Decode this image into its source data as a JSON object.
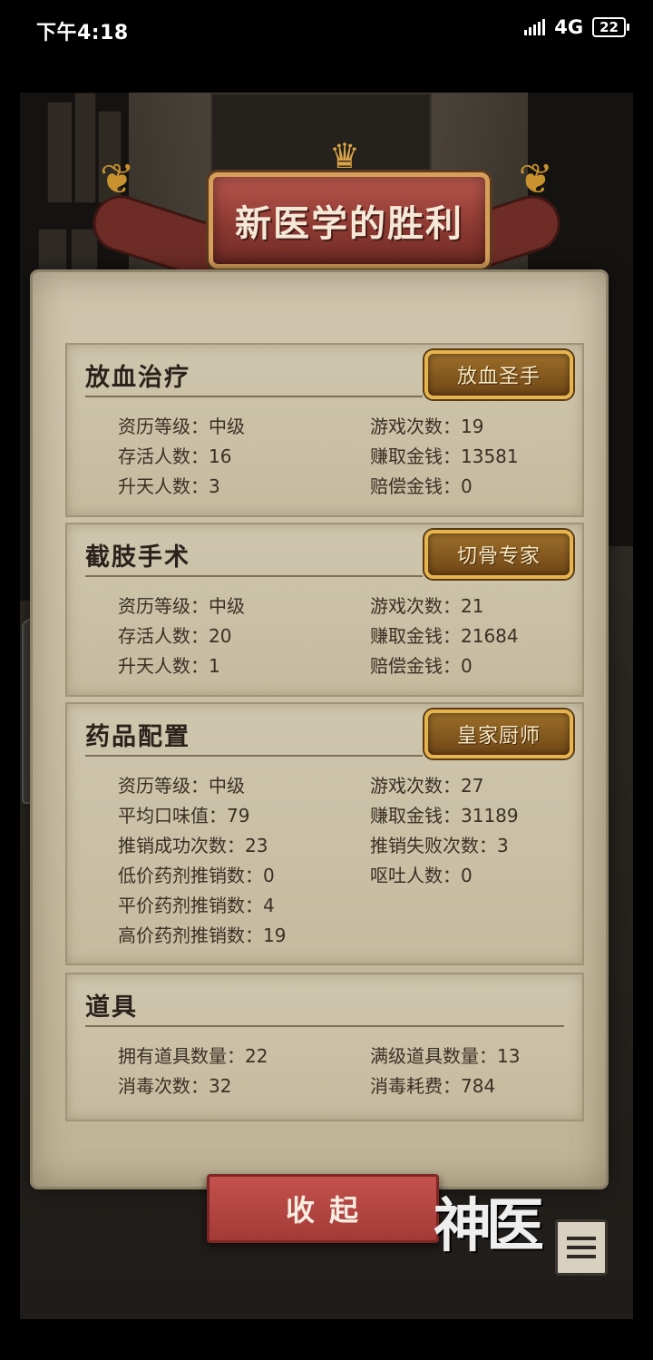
{
  "status_bar": {
    "time": "下午4:18",
    "network": "4G",
    "battery": "22"
  },
  "title": "新医学的胜利",
  "sections": [
    {
      "title": "放血治疗",
      "badge": "放血圣手",
      "stats_left": [
        "资历等级：中级",
        "存活人数：16",
        "升天人数：3"
      ],
      "stats_right": [
        "游戏次数：19",
        "赚取金钱：13581",
        "赔偿金钱：0"
      ]
    },
    {
      "title": "截肢手术",
      "badge": "切骨专家",
      "stats_left": [
        "资历等级：中级",
        "存活人数：20",
        "升天人数：1"
      ],
      "stats_right": [
        "游戏次数：21",
        "赚取金钱：21684",
        "赔偿金钱：0"
      ]
    },
    {
      "title": "药品配置",
      "badge": "皇家厨师",
      "stats_left": [
        "资历等级：中级",
        "平均口味值：79",
        "推销成功次数：23",
        "低价药剂推销数：0",
        "平价药剂推销数：4",
        "高价药剂推销数：19"
      ],
      "stats_right": [
        "游戏次数：27",
        "赚取金钱：31189",
        "推销失败次数：3",
        "呕吐人数：0"
      ]
    },
    {
      "title": "道具",
      "stats_left": [
        "拥有道具数量：22",
        "消毒次数：32"
      ],
      "stats_right": [
        "满级道具数量：13",
        "消毒耗费：784"
      ]
    }
  ],
  "collapse_button": "收起",
  "logo_text": "神医",
  "icons": {
    "menu": "menu-list-icon",
    "signal": "signal-icon",
    "battery": "battery-icon"
  }
}
